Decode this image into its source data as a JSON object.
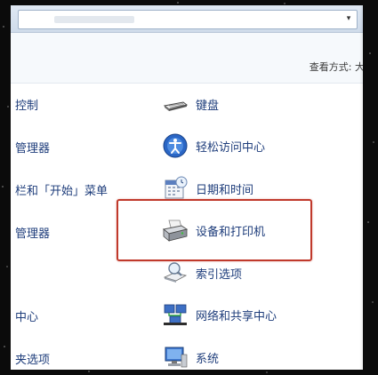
{
  "header": {
    "view_label": "查看方式: 大"
  },
  "left_column": [
    "控制",
    "管理器",
    "栏和「开始」菜单",
    "管理器",
    "中心",
    "夹选项"
  ],
  "right_column": [
    {
      "label": "键盘",
      "icon": "keyboard-icon"
    },
    {
      "label": "轻松访问中心",
      "icon": "ease-of-access-icon"
    },
    {
      "label": "日期和时间",
      "icon": "calendar-clock-icon"
    },
    {
      "label": "设备和打印机",
      "icon": "printer-icon"
    },
    {
      "label": "索引选项",
      "icon": "indexing-icon"
    },
    {
      "label": "网络和共享中心",
      "icon": "network-icon"
    },
    {
      "label": "系统",
      "icon": "system-icon"
    }
  ],
  "highlight": {
    "color": "#c0392b",
    "target": "设备和打印机"
  },
  "colors": {
    "link": "#1e3d7b",
    "window_bg": "#ffffff",
    "frame": "#0b0b0b"
  }
}
